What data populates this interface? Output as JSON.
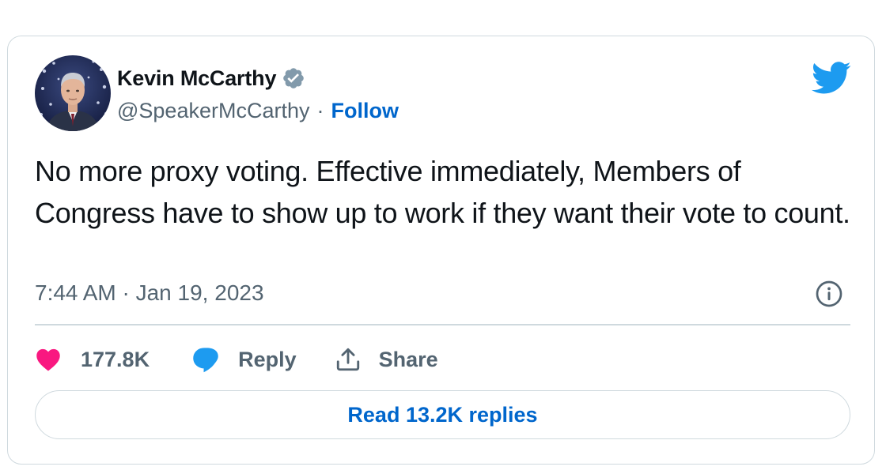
{
  "author": {
    "name": "Kevin McCarthy",
    "handle": "@SpeakerMcCarthy",
    "separator": "·",
    "follow_label": "Follow",
    "verified": true
  },
  "tweet": {
    "text": "No more proxy voting. Effective immediately, Members of Congress have to show up to work if they want their vote to count.",
    "timestamp": "7:44 AM · Jan 19, 2023"
  },
  "actions": {
    "like_count": "177.8K",
    "reply_label": "Reply",
    "share_label": "Share"
  },
  "read_replies_label": "Read 13.2K replies",
  "icons": {
    "brand": "twitter-bird-icon",
    "verified": "verified-badge-icon",
    "info": "info-icon",
    "like": "heart-icon",
    "reply": "speech-bubble-icon",
    "share": "share-upload-icon"
  },
  "colors": {
    "text_primary": "#0f1419",
    "text_secondary": "#536471",
    "link": "#0066cc",
    "twitter_blue": "#1d9bf0",
    "like_pink": "#f91880",
    "verified_gray": "#829aab",
    "border": "#cfd9de"
  }
}
